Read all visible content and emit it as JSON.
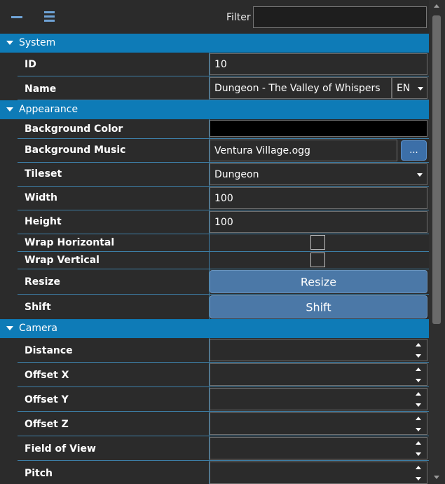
{
  "toolbar": {
    "collapse_icon": "minus-icon",
    "categorize_icon": "list-icon",
    "filter_label": "Filter",
    "filter_value": ""
  },
  "categories": {
    "system": "System",
    "appearance": "Appearance",
    "camera": "Camera"
  },
  "system": {
    "id_label": "ID",
    "id_value": "10",
    "name_label": "Name",
    "name_value": "Dungeon - The Valley of Whispers",
    "language": "EN"
  },
  "appearance": {
    "bg_color_label": "Background Color",
    "bg_color_value": "#000000",
    "bg_music_label": "Background Music",
    "bg_music_value": "Ventura Village.ogg",
    "browse_label": "...",
    "tileset_label": "Tileset",
    "tileset_value": "Dungeon",
    "width_label": "Width",
    "width_value": "100",
    "height_label": "Height",
    "height_value": "100",
    "wrap_h_label": "Wrap Horizontal",
    "wrap_v_label": "Wrap Vertical",
    "resize_label": "Resize",
    "resize_button": "Resize",
    "shift_label": "Shift",
    "shift_button": "Shift"
  },
  "camera": {
    "distance_label": "Distance",
    "offset_x_label": "Offset X",
    "offset_y_label": "Offset Y",
    "offset_z_label": "Offset Z",
    "fov_label": "Field of View",
    "pitch_label": "Pitch"
  },
  "colors": {
    "category_bar": "#0e7bb7",
    "button": "#4b78a7",
    "background": "#2b2b2b"
  }
}
